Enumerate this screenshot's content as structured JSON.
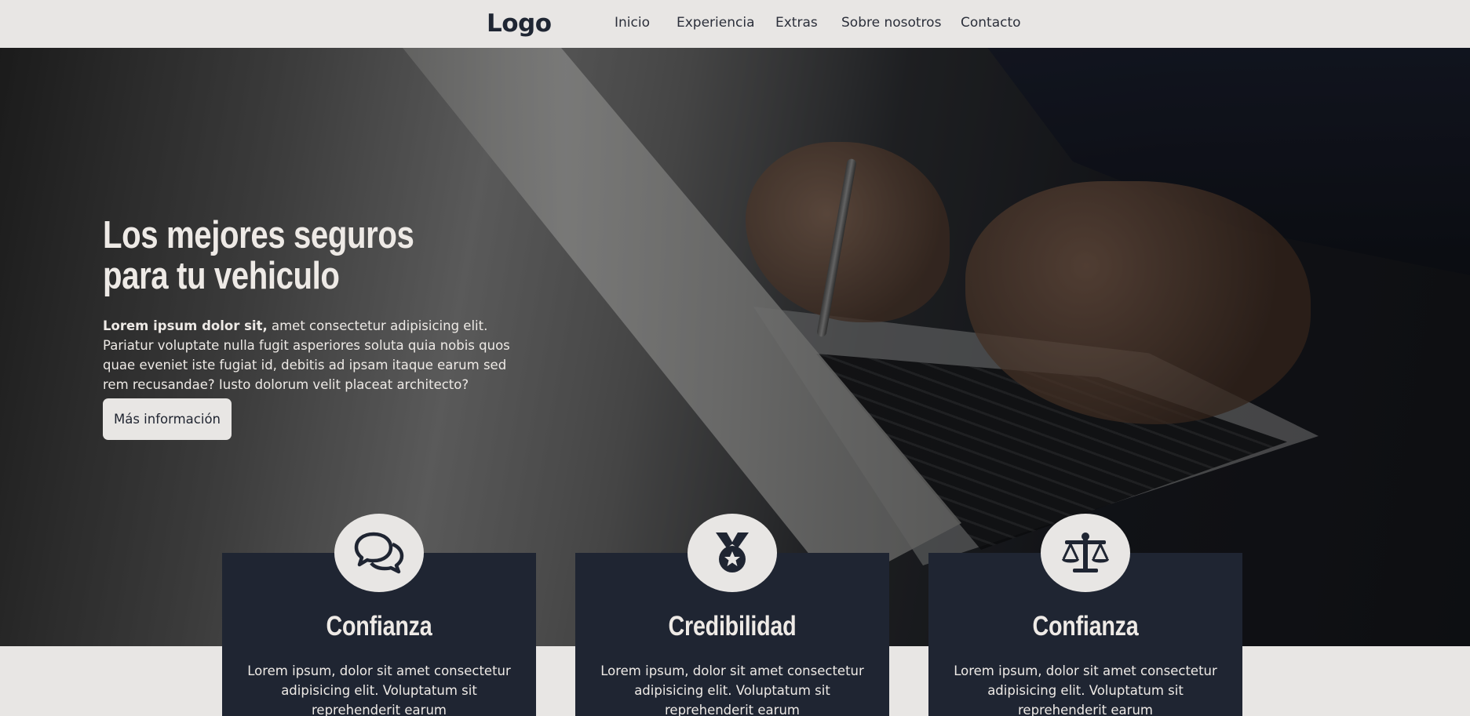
{
  "header": {
    "logo": "Logo",
    "nav": [
      {
        "label": "Inicio"
      },
      {
        "label": "Experiencia"
      },
      {
        "label": "Extras"
      },
      {
        "label": "Sobre nosotros"
      },
      {
        "label": "Contacto"
      }
    ]
  },
  "hero": {
    "title_line1": "Los mejores seguros",
    "title_line2": "para tu vehiculo",
    "text_bold": "Lorem ipsum dolor sit,",
    "text_rest": " amet consectetur adipisicing elit. Pariatur voluptate nulla fugit asperiores soluta quia nobis quos quae eveniet iste fugiat id, debitis ad ipsam itaque earum sed rem recusandae? Iusto dolorum velit placeat architecto?",
    "button_label": "Más información"
  },
  "features": [
    {
      "icon": "chat-bubbles-icon",
      "title": "Confianza",
      "text": "Lorem ipsum, dolor sit amet consectetur adipisicing elit. Voluptatum sit reprehenderit earum"
    },
    {
      "icon": "medal-icon",
      "title": "Credibilidad",
      "text": "Lorem ipsum, dolor sit amet consectetur adipisicing elit. Voluptatum sit reprehenderit earum"
    },
    {
      "icon": "balance-scale-icon",
      "title": "Confianza",
      "text": "Lorem ipsum, dolor sit amet consectetur adipisicing elit. Voluptatum sit reprehenderit earum"
    }
  ],
  "colors": {
    "background": "#e8e6e4",
    "card": "#1f2532",
    "text_light": "#eeeae6",
    "text_dark": "#1f2430"
  }
}
